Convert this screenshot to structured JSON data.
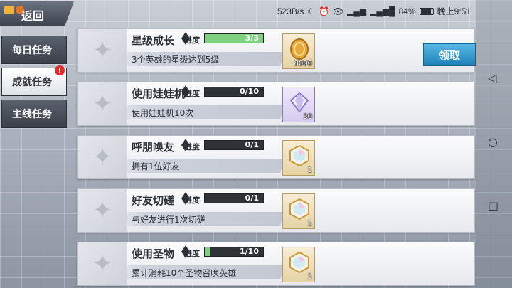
{
  "statusbar": {
    "net_speed": "523B/s",
    "battery_percent": "84%",
    "time": "晚上9:51"
  },
  "back": {
    "label": "返回"
  },
  "side_tabs": [
    {
      "label": "每日任务",
      "active": false,
      "alert": ""
    },
    {
      "label": "成就任务",
      "active": true,
      "alert": "!"
    },
    {
      "label": "主线任务",
      "active": false,
      "alert": ""
    }
  ],
  "progress_label": "进度",
  "claim_label": "领取",
  "tasks": [
    {
      "title": "星级成长",
      "progress_text": "3/3",
      "progress": 1.0,
      "desc": "3个英雄的星级达到5级",
      "reward_icon": "gold-coin-icon",
      "reward_qty": "8000",
      "claimable": true
    },
    {
      "title": "使用娃娃机",
      "progress_text": "0/10",
      "progress": 0.0,
      "desc": "使用娃娃机10次",
      "reward_icon": "diamond-icon",
      "reward_qty": "30",
      "claimable": false
    },
    {
      "title": "呼朋唤友",
      "progress_text": "0/1",
      "progress": 0.0,
      "desc": "拥有1位好友",
      "reward_icon": "rainbow-gem-icon",
      "reward_qty": "1",
      "claimable": false
    },
    {
      "title": "好友切磋",
      "progress_text": "0/1",
      "progress": 0.0,
      "desc": "与好友进行1次切磋",
      "reward_icon": "rainbow-gem-icon",
      "reward_qty": "1",
      "claimable": false
    },
    {
      "title": "使用圣物",
      "progress_text": "1/10",
      "progress": 0.1,
      "desc": "累计消耗10个圣物召唤英雄",
      "reward_icon": "rainbow-gem-icon",
      "reward_qty": "1",
      "claimable": false
    }
  ],
  "colors": {
    "progress_fill": "#7fd17f",
    "claim_button": "#2a95cc",
    "alert_badge": "#e22b2b"
  }
}
